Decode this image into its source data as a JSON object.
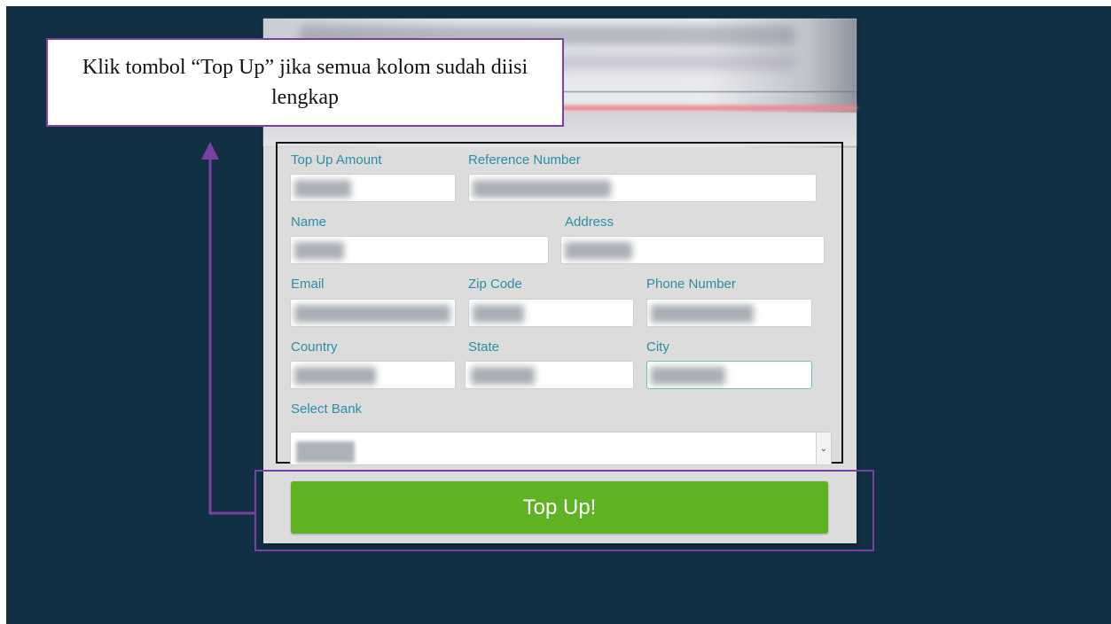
{
  "callout": {
    "text": "Klik tombol “Top Up” jika semua kolom sudah diisi lengkap"
  },
  "form": {
    "labels": {
      "top_up_amount": "Top Up Amount",
      "reference_number": "Reference Number",
      "name": "Name",
      "address": "Address",
      "email": "Email",
      "zip_code": "Zip Code",
      "phone_number": "Phone Number",
      "country": "Country",
      "state": "State",
      "city": "City",
      "select_bank": "Select Bank"
    },
    "select_bank_arrow": "⌄",
    "submit_label": "Top Up!"
  },
  "colors": {
    "background": "#123044",
    "label": "#2a8ea6",
    "button": "#5fb323",
    "annotation": "#7c40a3"
  },
  "icons": {
    "select_arrow": "chevron-down-icon",
    "annotation_arrow": "arrow-up-icon"
  }
}
